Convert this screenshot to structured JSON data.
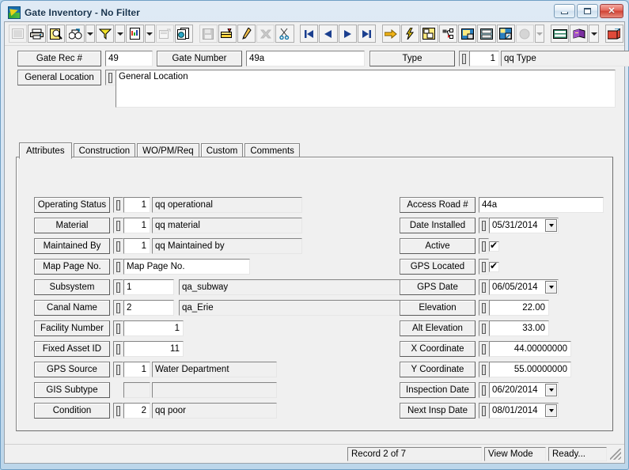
{
  "window": {
    "title": "Gate Inventory - No Filter",
    "app_icon": "gate-app-icon",
    "minimize_label": "Minimize",
    "maximize_label": "Maximize",
    "close_label": "✕"
  },
  "toolbar": {
    "items": [
      {
        "name": "select-tool-icon",
        "disabled": true
      },
      {
        "name": "print-icon",
        "disabled": false
      },
      {
        "name": "print-preview-icon",
        "disabled": false
      },
      {
        "name": "find-icon",
        "disabled": false
      },
      {
        "name": "find-dropdown-arrow",
        "disabled": false
      },
      {
        "name": "filter-icon",
        "disabled": false
      },
      {
        "name": "filter-dropdown-arrow",
        "disabled": false
      },
      {
        "name": "report-icon",
        "disabled": false
      },
      {
        "name": "report-dropdown-arrow",
        "disabled": false
      },
      {
        "name": "form-properties-icon",
        "disabled": true
      },
      {
        "name": "copy-record-icon",
        "disabled": false
      },
      {
        "name": "save-icon",
        "disabled": true
      },
      {
        "name": "new-record-icon",
        "disabled": false
      },
      {
        "name": "edit-record-icon",
        "disabled": false
      },
      {
        "name": "delete-record-icon",
        "disabled": true
      },
      {
        "name": "cut-icon",
        "disabled": false
      },
      {
        "name": "first-record-icon",
        "disabled": false
      },
      {
        "name": "previous-record-icon",
        "disabled": false
      },
      {
        "name": "next-record-icon",
        "disabled": false
      },
      {
        "name": "last-record-icon",
        "disabled": false
      },
      {
        "name": "goto-icon",
        "disabled": false
      },
      {
        "name": "lightning-icon",
        "disabled": false
      },
      {
        "name": "map-icon",
        "disabled": false
      },
      {
        "name": "hierarchy-icon",
        "disabled": false
      },
      {
        "name": "image-icon",
        "disabled": false
      },
      {
        "name": "fax-icon",
        "disabled": false
      },
      {
        "name": "gis-link-icon",
        "disabled": false
      },
      {
        "name": "help-ball-icon",
        "disabled": true
      },
      {
        "name": "help-dropdown-arrow",
        "disabled": true
      },
      {
        "name": "keyboard-icon",
        "disabled": false
      },
      {
        "name": "book-icon",
        "disabled": false
      },
      {
        "name": "book-dropdown-arrow",
        "disabled": false
      },
      {
        "name": "exit-icon",
        "disabled": false
      }
    ]
  },
  "header": {
    "gate_rec_label": "Gate Rec #",
    "gate_rec_value": "49",
    "gate_number_label": "Gate Number",
    "gate_number_value": "49a",
    "type_label": "Type",
    "type_code": "1",
    "type_desc": "qq Type",
    "general_location_label": "General Location",
    "general_location_value": "General Location"
  },
  "tabs": [
    {
      "label": "Attributes",
      "active": true
    },
    {
      "label": "Construction",
      "active": false
    },
    {
      "label": "WO/PM/Req",
      "active": false
    },
    {
      "label": "Custom",
      "active": false
    },
    {
      "label": "Comments",
      "active": false
    }
  ],
  "attributes": {
    "left": [
      {
        "label": "Operating Status",
        "code": "1",
        "desc": "qq operational",
        "kind": "code-desc"
      },
      {
        "label": "Material",
        "code": "1",
        "desc": "qq material",
        "kind": "code-desc"
      },
      {
        "label": "Maintained By",
        "code": "1",
        "desc": "qq Maintained by",
        "kind": "code-desc"
      },
      {
        "label": "Map Page No.",
        "value": "Map Page No.",
        "kind": "text"
      },
      {
        "label": "Subsystem",
        "code": "1",
        "desc": "qa_subway",
        "kind": "code-desc-wide"
      },
      {
        "label": "Canal Name",
        "code": "2",
        "desc": "qa_Erie",
        "kind": "code-desc-wide"
      },
      {
        "label": "Facility Number",
        "value": "1",
        "kind": "number"
      },
      {
        "label": "Fixed Asset ID",
        "value": "11",
        "kind": "number"
      },
      {
        "label": "GPS Source",
        "code": "1",
        "desc": "Water Department",
        "kind": "code-desc"
      },
      {
        "label": "GIS Subtype",
        "code": "",
        "desc": "",
        "kind": "code-desc-empty"
      },
      {
        "label": "Condition",
        "code": "2",
        "desc": "qq poor",
        "kind": "code-desc"
      }
    ],
    "right": [
      {
        "label": "Access Road #",
        "value": "44a",
        "kind": "text-nospin"
      },
      {
        "label": "Date Installed",
        "value": "05/31/2014",
        "kind": "date"
      },
      {
        "label": "Active",
        "value": true,
        "kind": "check"
      },
      {
        "label": "GPS Located",
        "value": true,
        "kind": "check"
      },
      {
        "label": "GPS Date",
        "value": "06/05/2014",
        "kind": "date"
      },
      {
        "label": "Elevation",
        "value": "22.00",
        "kind": "number"
      },
      {
        "label": "Alt Elevation",
        "value": "33.00",
        "kind": "number"
      },
      {
        "label": "X Coordinate",
        "value": "44.00000000",
        "kind": "number-wide"
      },
      {
        "label": "Y Coordinate",
        "value": "55.00000000",
        "kind": "number-wide"
      },
      {
        "label": "Inspection Date",
        "value": "06/20/2014",
        "kind": "date"
      },
      {
        "label": "Next Insp Date",
        "value": "08/01/2014",
        "kind": "date"
      }
    ]
  },
  "status": {
    "record": "Record 2 of 7",
    "mode": "View Mode",
    "state": "Ready..."
  },
  "colors": {
    "window_frame": "#6f9fc4",
    "client_bg": "#f0f0f0",
    "field_bg": "#ffffff",
    "readonly_bg": "#f0f0f0",
    "close_button": "#cf4233"
  }
}
